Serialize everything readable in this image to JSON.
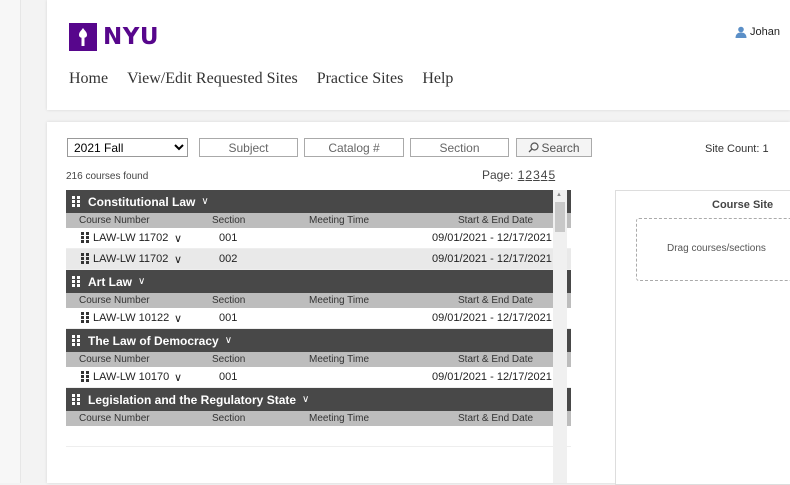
{
  "header": {
    "logo_text": "NYU",
    "user_name": "Johan",
    "nav": [
      "Home",
      "View/Edit Requested Sites",
      "Practice Sites",
      "Help"
    ]
  },
  "toolbar": {
    "term_selected": "2021 Fall",
    "subject_placeholder": "Subject",
    "catalog_placeholder": "Catalog #",
    "section_placeholder": "Section",
    "search_label": "Search"
  },
  "results": {
    "found": "216 courses found",
    "page_label": "Page:",
    "pages": [
      "1",
      "2",
      "3",
      "4",
      "5"
    ]
  },
  "columns": {
    "course_number": "Course Number",
    "section": "Section",
    "meeting_time": "Meeting Time",
    "dates": "Start & End Date"
  },
  "groups": [
    {
      "title": "Constitutional Law",
      "rows": [
        {
          "course": "LAW-LW 11702",
          "section": "001",
          "meeting": "",
          "dates": "09/01/2021 - 12/17/2021"
        },
        {
          "course": "LAW-LW 11702",
          "section": "002",
          "meeting": "",
          "dates": "09/01/2021 - 12/17/2021"
        }
      ]
    },
    {
      "title": "Art Law",
      "rows": [
        {
          "course": "LAW-LW 10122",
          "section": "001",
          "meeting": "",
          "dates": "09/01/2021 - 12/17/2021"
        }
      ]
    },
    {
      "title": "The Law of Democracy",
      "rows": [
        {
          "course": "LAW-LW 10170",
          "section": "001",
          "meeting": "",
          "dates": "09/01/2021 - 12/17/2021"
        }
      ]
    },
    {
      "title": "Legislation and the Regulatory State",
      "rows": []
    }
  ],
  "site_panel": {
    "site_count_label": "Site Count:",
    "site_count_value": "1",
    "title": "Course Site",
    "drop_text": "Drag courses/sections"
  },
  "colors": {
    "brand": "#57068c",
    "group_header": "#484848",
    "column_header": "#bdbdbd"
  }
}
